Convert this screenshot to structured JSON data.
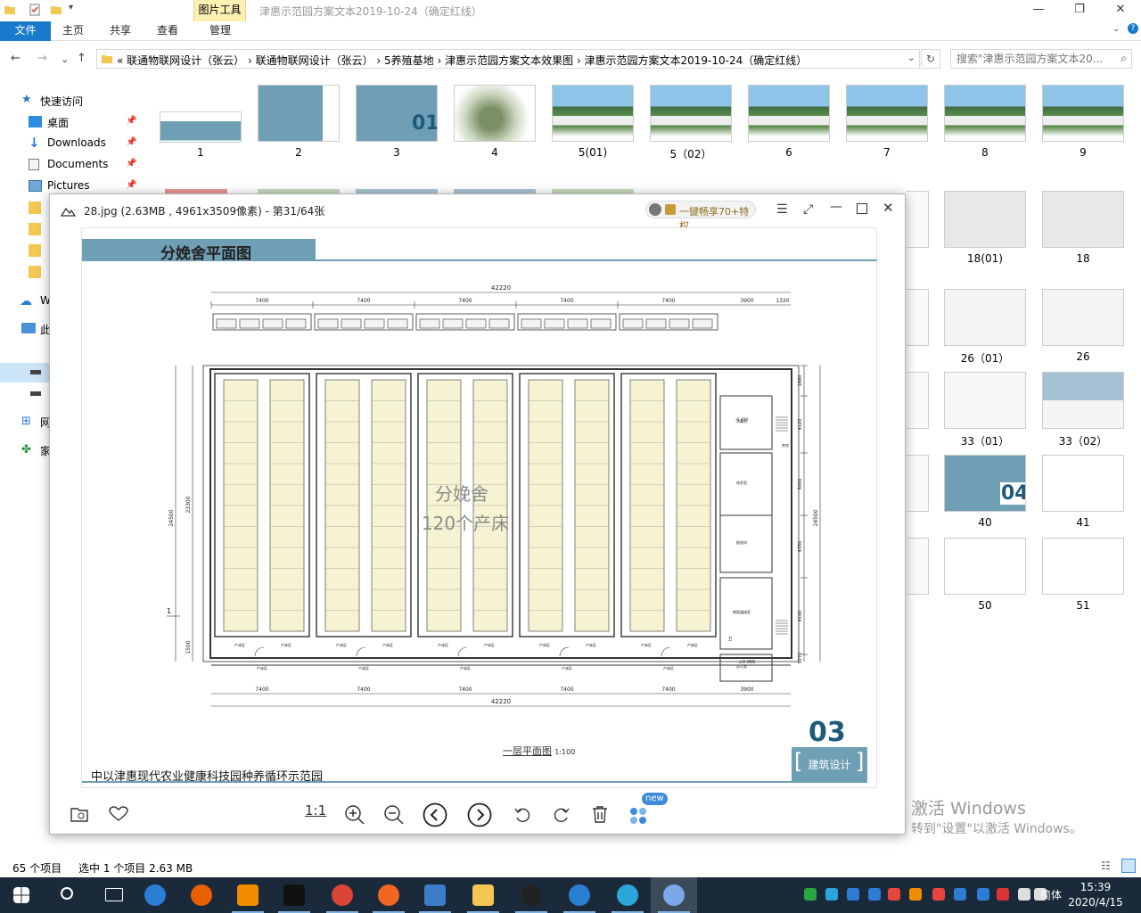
{
  "window": {
    "title": "津惠示范园方案文本2019-10-24（确定红线）",
    "context_tab_group": "图片工具",
    "min_glyph": "—",
    "max_glyph": "❐",
    "close_glyph": "✕"
  },
  "ribbon": {
    "file": "文件",
    "tabs": [
      "主页",
      "共享",
      "查看",
      "管理"
    ],
    "help_glyph": "?"
  },
  "navigation": {
    "back": "←",
    "forward": "→",
    "recent": "⌄",
    "up": "↑",
    "breadcrumb": "«  联通物联网设计（张云）  ›  联通物联网设计（张云）  ›  5养殖基地  ›  津惠示范园方案文本效果图  ›  津惠示范园方案文本2019-10-24（确定红线）",
    "refresh": "↻",
    "search_placeholder": "搜索\"津惠示范园方案文本20...",
    "search_icon": "⌕"
  },
  "sidebar": {
    "quick_access": "快速访问",
    "items": [
      {
        "label": "桌面",
        "icon": "desktop-icon",
        "pinned": true
      },
      {
        "label": "Downloads",
        "icon": "download-icon",
        "pinned": true
      },
      {
        "label": "Documents",
        "icon": "documents-icon",
        "pinned": true
      },
      {
        "label": "Pictures",
        "icon": "pictures-icon",
        "pinned": true
      }
    ],
    "partial_labels": [
      "W",
      "此",
      "网",
      "家"
    ]
  },
  "thumbnails_row1": [
    "1",
    "2",
    "3",
    "4",
    "5(01)",
    "5（02）",
    "6",
    "7",
    "8",
    "9"
  ],
  "thumbnails_right": [
    "18(01)",
    "18",
    "26（01）",
    "26",
    "33（01）",
    "33（02）",
    "40",
    "41",
    "50",
    "51"
  ],
  "viewer": {
    "title": "28.jpg (2.63MB , 4961x3509像素) - 第31/64张",
    "promo": "一键畅享70+特权",
    "page": {
      "heading": "分娩舍平面图",
      "page_number": "03",
      "section": "建筑设计",
      "footer": "中以津惠现代农业健康科技园种养循环示范园",
      "plan_label": "一层平面图",
      "scale": "1:100",
      "overlay_line1": "分娩舍",
      "overlay_line2": "120个产床",
      "dims": {
        "total": "42220",
        "bay": "7400",
        "side": "3900",
        "end": "1320",
        "height_left": "24500",
        "height_inner": "23300",
        "height_right": "24500",
        "right_segments": [
          "1660",
          "4120",
          "5000",
          "4350",
          "4100",
          "5270"
        ],
        "bottom_left": "1500",
        "level": "-0.400",
        "level2": "±0.000",
        "marker": "1",
        "bed_label": "产床区",
        "room_labels": [
          "消毒间",
          "库房",
          "休息室",
          "配电间",
          "兽医器械室",
          "办公室",
          "卫"
        ]
      }
    },
    "toolbar": {
      "actual_size": "1:1",
      "new_badge": "new"
    }
  },
  "watermark": {
    "line1": "激活 Windows",
    "line2": "转到\"设置\"以激活 Windows。"
  },
  "statusbar": {
    "count": "65 个项目",
    "selected": "选中 1 个项目  2.63 MB"
  },
  "taskbar": {
    "ime": "简体",
    "time": "15:39",
    "date": "2020/4/15"
  },
  "colors": {
    "accent": "#1979ca",
    "doc_band": "#6f9fb5",
    "page_number": "#1e5a7a",
    "bed_fill": "#f5f3d2",
    "context_tab": "#fdf0b3"
  }
}
